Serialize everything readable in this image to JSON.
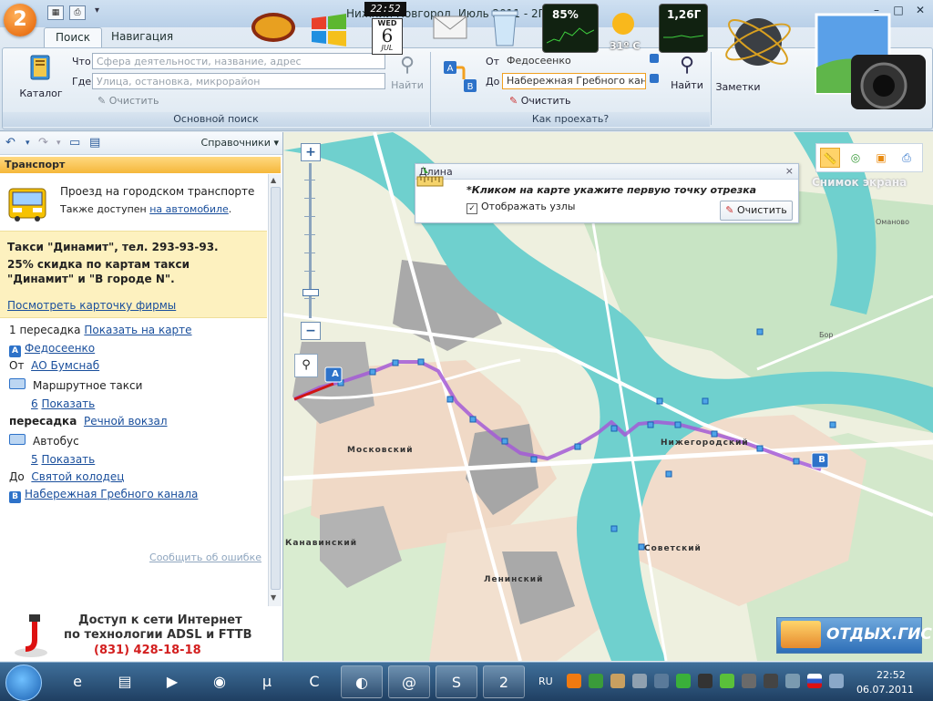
{
  "window": {
    "title": "Нижний Новгород, Июль 2011 - 2ГИС",
    "logo_text": "2"
  },
  "ribbon": {
    "tabs": [
      {
        "label": "Поиск"
      },
      {
        "label": "Навигация"
      }
    ],
    "catalog_label": "Каталог",
    "search": {
      "what_label": "Что",
      "what_placeholder": "Сфера деятельности, название, адрес",
      "where_label": "Где",
      "where_placeholder": "Улица, остановка, микрорайон",
      "clear_label": "Очистить",
      "find_label": "Найти",
      "group_caption": "Основной поиск"
    },
    "route": {
      "from_label": "От",
      "from_value": "Федосеенко",
      "to_label": "До",
      "to_value": "Набережная Гребного канала",
      "clear_label": "Очистить",
      "find_label": "Найти",
      "group_caption": "Как проехать?"
    },
    "notes_label": "Заметки"
  },
  "left_panel": {
    "reference_menu": "Справочники",
    "header": "Транспорт",
    "bus_title": "Проезд на городском транспорте",
    "bus_sub_prefix": "Также доступен",
    "bus_sub_link": "на автомобиле",
    "ad": {
      "title": "Такси \"Динамит\", тел. 293-93-93.",
      "text": "25% скидка по картам такси \"Динамит\" и \"В городе N\".",
      "link": "Посмотреть карточку фирмы"
    },
    "route": {
      "transfers": "1 пересадка",
      "show_on_map": "Показать на карте",
      "start_pin": "A",
      "start": "Федосеенко",
      "from_label": "От",
      "from_stop": "АО Бумснаб",
      "leg1_mode": "Маршрутное такси",
      "leg1_count": "6",
      "leg1_show": "Показать",
      "transfer_label": "пересадка",
      "transfer_stop": "Речной вокзал",
      "leg2_mode": "Автобус",
      "leg2_count": "5",
      "leg2_show": "Показать",
      "to_label": "До",
      "to_stop": "Святой колодец",
      "end_pin": "B",
      "end": "Набережная Гребного канала"
    },
    "report_error": "Сообщить об ошибке",
    "banner": {
      "line1": "Доступ к сети Интернет",
      "line2": "по технологии ADSL и FTTB",
      "phone": "(831) 428-18-18"
    }
  },
  "map": {
    "measure": {
      "title": "Длина",
      "close": "×",
      "hint": "*Кликом на карте укажите первую точку отрезка",
      "show_nodes": "Отображать узлы",
      "clear": "Очистить"
    },
    "snapshot_label": "Снимок экрана",
    "otdyh_label": "ОТДЫХ.ГИС",
    "labels": {
      "moskovsky": "Московский",
      "nizhegorodsky": "Нижегородский",
      "kanavinsky": "Канавинский",
      "leninsky": "Ленинский",
      "sovetsky": "Советский",
      "bor": "Бор",
      "omanovo": "Оманово"
    },
    "pin_a": "A",
    "pin_b": "B",
    "zoom_in": "+",
    "zoom_out": "−"
  },
  "gadgets": {
    "clock_time": "22:52",
    "cal_day": "WED",
    "cal_num": "6",
    "cal_month": "JUL",
    "cpu": "85%",
    "temperature": "31º C",
    "ram": "1,26Г"
  },
  "taskbar": {
    "lang": "RU",
    "time": "22:52",
    "date": "06.07.2011"
  }
}
